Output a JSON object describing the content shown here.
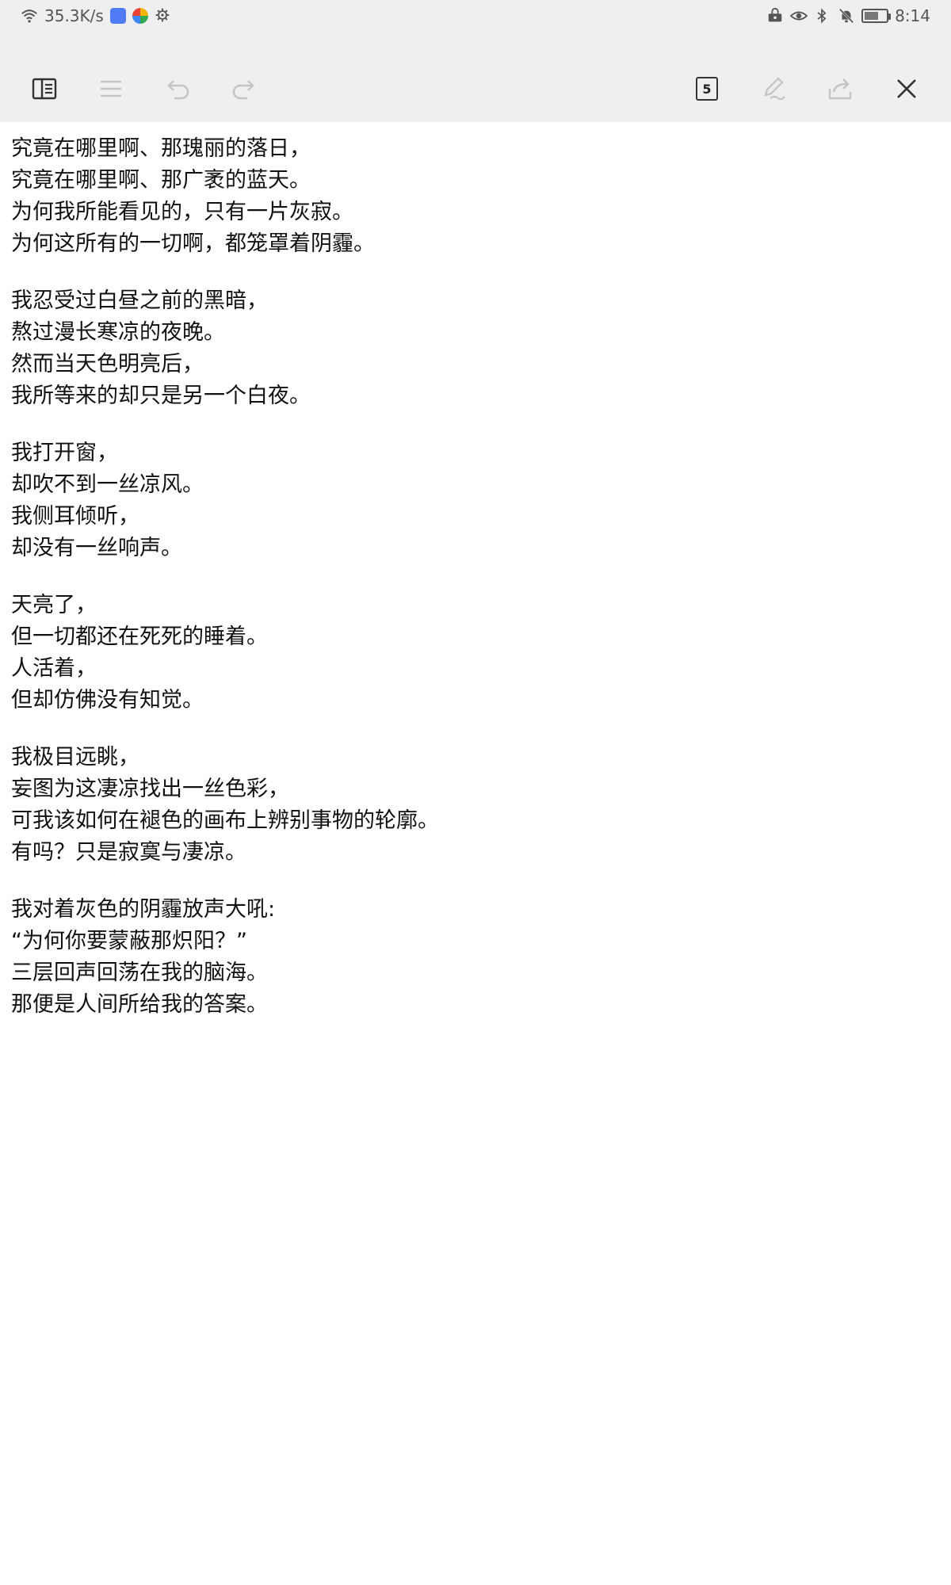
{
  "status_bar": {
    "network_speed": "35.3K/s",
    "time": "8:14",
    "icons": [
      "wifi-icon",
      "app-notification-icon",
      "app-notification-icon",
      "gear-icon",
      "vpn-icon",
      "eye-icon",
      "bluetooth-icon",
      "silent-icon",
      "battery-icon"
    ]
  },
  "toolbar": {
    "page_count": "5",
    "icons": [
      "sidebar-toggle-icon",
      "list-icon",
      "undo-icon",
      "redo-icon",
      "page-count-icon",
      "pen-icon",
      "share-icon",
      "close-icon"
    ]
  },
  "document": {
    "stanzas": [
      [
        "究竟在哪里啊、那瑰丽的落日，",
        "究竟在哪里啊、那广袤的蓝天。",
        "为何我所能看见的，只有一片灰寂。",
        "为何这所有的一切啊，都笼罩着阴霾。"
      ],
      [
        "我忍受过白昼之前的黑暗，",
        "熬过漫长寒凉的夜晚。",
        "然而当天色明亮后，",
        "我所等来的却只是另一个白夜。"
      ],
      [
        "我打开窗，",
        "却吹不到一丝凉风。",
        "我侧耳倾听，",
        "却没有一丝响声。"
      ],
      [
        "天亮了，",
        "但一切都还在死死的睡着。",
        "人活着，",
        "但却仿佛没有知觉。"
      ],
      [
        "我极目远眺，",
        "妄图为这凄凉找出一丝色彩，",
        "可我该如何在褪色的画布上辨别事物的轮廓。",
        "有吗？只是寂寞与凄凉。"
      ],
      [
        "我对着灰色的阴霾放声大吼:",
        "“为何你要蒙蔽那炽阳？”",
        "三层回声回荡在我的脑海。",
        "那便是人间所给我的答案。"
      ]
    ]
  }
}
